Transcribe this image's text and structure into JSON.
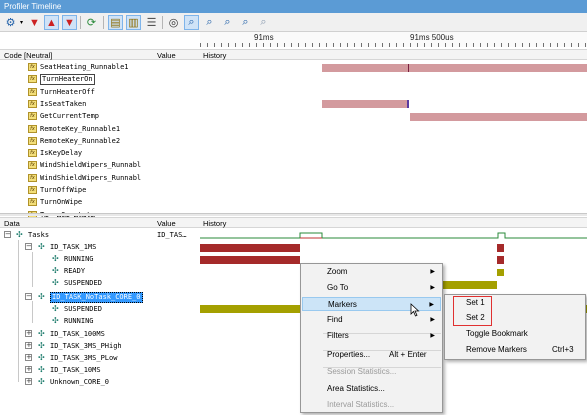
{
  "window": {
    "title": "Profiler Timeline"
  },
  "toolbar": {
    "buttons": [
      "gear-icon",
      "filter-red-icon",
      "filter-up-icon",
      "filter-down-icon",
      "refresh-icon",
      "save-icon",
      "export-icon",
      "chart-icon",
      "binoculars-icon",
      "cursor-zoom-icon",
      "zoom-in-icon",
      "zoom-out-icon",
      "zoom-fit-icon",
      "zoom-reset-icon"
    ]
  },
  "ruler": {
    "label_left": "91ms",
    "label_right": "91ms 500us"
  },
  "top_header": {
    "col1": "Code [Neutral]",
    "col2": "Value",
    "col3": "History"
  },
  "code_rows": [
    {
      "label": "SeatHeating_Runnable1"
    },
    {
      "label": "TurnHeaterOn"
    },
    {
      "label": "TurnHeaterOff"
    },
    {
      "label": "IsSeatTaken"
    },
    {
      "label": "GetCurrentTemp"
    },
    {
      "label": "RemoteKey_Runnable1"
    },
    {
      "label": "RemoteKey_Runnable2"
    },
    {
      "label": "IsKeyDelay"
    },
    {
      "label": "WindShieldWipers_Runnabl"
    },
    {
      "label": "WindShieldWipers_Runnabl"
    },
    {
      "label": "TurnOffWipe"
    },
    {
      "label": "TurnOnWipe"
    },
    {
      "label": "T…_ …O…_…t…t…"
    }
  ],
  "data_header": {
    "col1": "Data",
    "col2": "Value",
    "col3": "History"
  },
  "data_rows": [
    {
      "label": "Tasks",
      "value": "ID_TAS…"
    },
    {
      "label": "ID_TASK_1MS"
    },
    {
      "label": "RUNNING"
    },
    {
      "label": "READY"
    },
    {
      "label": "SUSPENDED"
    },
    {
      "label": "ID_TASK_NoTask_CORE_0"
    },
    {
      "label": "SUSPENDED"
    },
    {
      "label": "RUNNING"
    },
    {
      "label": "ID_TASK_100MS"
    },
    {
      "label": "ID_TASK_3MS_PHigh"
    },
    {
      "label": "ID_TASK_3MS_PLow"
    },
    {
      "label": "ID_TASK_10MS"
    },
    {
      "label": "Unknown_CORE_0"
    }
  ],
  "context_menu": {
    "items": [
      {
        "label": "Zoom",
        "submenu": true
      },
      {
        "label": "Go To",
        "submenu": true
      },
      {
        "label": "Markers",
        "submenu": true
      },
      {
        "label": "Find",
        "submenu": true
      },
      {
        "label": "Filters",
        "submenu": true
      },
      {
        "label": "Properties...",
        "shortcut": "Alt + Enter"
      },
      {
        "label": "Session Statistics...",
        "disabled": true
      },
      {
        "label": "Area Statistics..."
      },
      {
        "label": "Interval Statistics...",
        "disabled": true
      }
    ]
  },
  "markers_submenu": {
    "items": [
      {
        "label": "Set 1"
      },
      {
        "label": "Set 2"
      },
      {
        "label": "Toggle Bookmark"
      },
      {
        "label": "Remove Markers",
        "shortcut": "Ctrl+3"
      }
    ]
  },
  "colors": {
    "pink": "#d39a9e",
    "darkred": "#a52a2a",
    "olive": "#a4a000",
    "highlight": "#3399ff",
    "titlebar": "#5b9bd5"
  }
}
